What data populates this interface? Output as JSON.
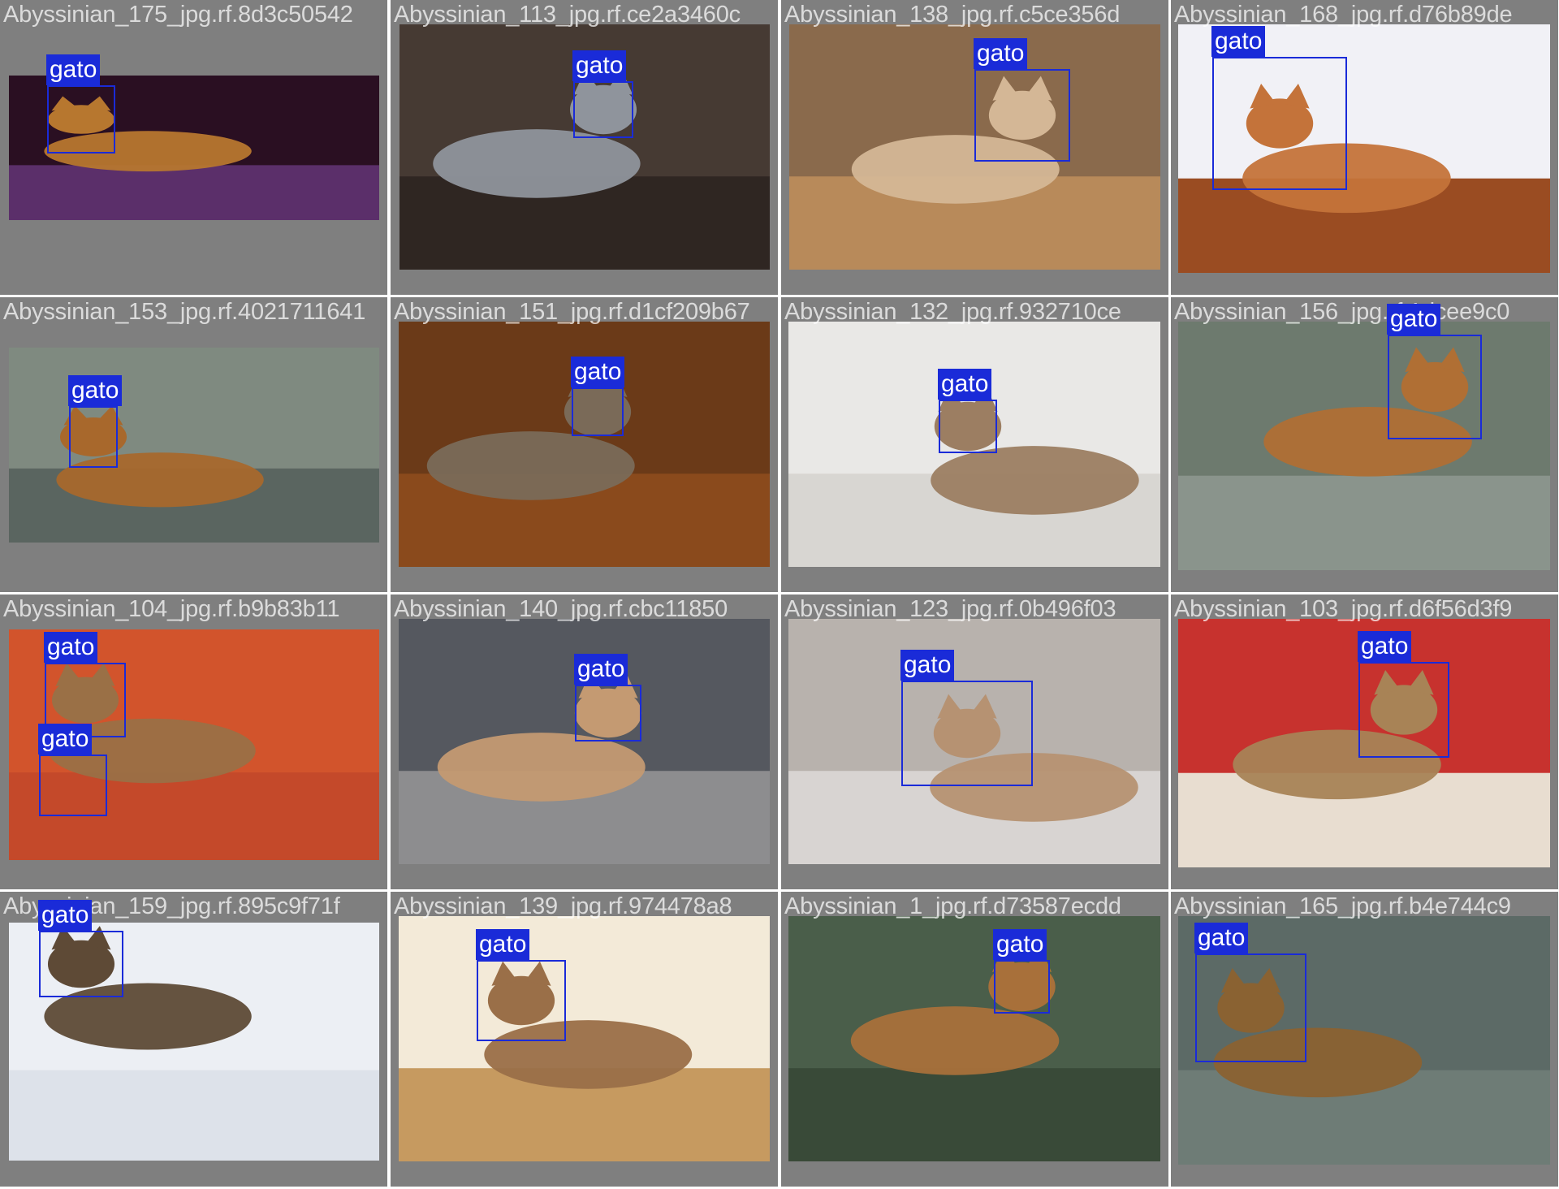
{
  "detection_color": "#1a2bd8",
  "tiles": [
    {
      "filename": "Abyssinian_175_jpg.rf.8d3c50542",
      "detections": [
        {
          "label": "gato"
        }
      ],
      "scene": {
        "bg": "#2a0f22",
        "floor": "#5b2f6a",
        "cat": "#b7772f"
      }
    },
    {
      "filename": "Abyssinian_113_jpg.rf.ce2a3460c",
      "detections": [
        {
          "label": "gato"
        }
      ],
      "scene": {
        "bg": "#463a33",
        "floor": "#2f2622",
        "cat": "#8f949c"
      }
    },
    {
      "filename": "Abyssinian_138_jpg.rf.c5ce356d",
      "detections": [
        {
          "label": "gato"
        }
      ],
      "scene": {
        "bg": "#8a6a4c",
        "floor": "#b88a5a",
        "cat": "#d4b796"
      }
    },
    {
      "filename": "Abyssinian_168_jpg.rf.d76b89de",
      "detections": [
        {
          "label": "gato"
        }
      ],
      "scene": {
        "bg": "#f1f1f6",
        "floor": "#9a4c22",
        "cat": "#c4733a"
      }
    },
    {
      "filename": "Abyssinian_153_jpg.rf.4021711641",
      "detections": [
        {
          "label": "gato"
        }
      ],
      "scene": {
        "bg": "#7f8a80",
        "floor": "#5a6560",
        "cat": "#a8682c"
      }
    },
    {
      "filename": "Abyssinian_151_jpg.rf.d1cf209b67",
      "detections": [
        {
          "label": "gato"
        }
      ],
      "scene": {
        "bg": "#6b3a18",
        "floor": "#8a4a1c",
        "cat": "#7a6a58"
      }
    },
    {
      "filename": "Abyssinian_132_jpg.rf.932710ce",
      "detections": [
        {
          "label": "gato"
        }
      ],
      "scene": {
        "bg": "#e9e8e6",
        "floor": "#d8d6d2",
        "cat": "#9c7e62"
      }
    },
    {
      "filename": "Abyssinian_156_jpg.rf.1dcee9c0",
      "detections": [
        {
          "label": "gato"
        }
      ],
      "scene": {
        "bg": "#6d7a6e",
        "floor": "#8a948c",
        "cat": "#b06f34"
      }
    },
    {
      "filename": "Abyssinian_104_jpg.rf.b9b83b11",
      "detections": [
        {
          "label": "gato"
        },
        {
          "label": "gato"
        }
      ],
      "scene": {
        "bg": "#d2542c",
        "floor": "#c4492a",
        "cat": "#9a7046"
      }
    },
    {
      "filename": "Abyssinian_140_jpg.rf.cbc11850",
      "detections": [
        {
          "label": "gato"
        }
      ],
      "scene": {
        "bg": "#55585f",
        "floor": "#8d8d8f",
        "cat": "#c49a72"
      }
    },
    {
      "filename": "Abyssinian_123_jpg.rf.0b496f03",
      "detections": [
        {
          "label": "gato"
        }
      ],
      "scene": {
        "bg": "#b8b2ad",
        "floor": "#d8d4d2",
        "cat": "#b69272"
      }
    },
    {
      "filename": "Abyssinian_103_jpg.rf.d6f56d3f9",
      "detections": [
        {
          "label": "gato"
        }
      ],
      "scene": {
        "bg": "#c7322e",
        "floor": "#e8ddd0",
        "cat": "#a88356"
      }
    },
    {
      "filename": "Abyssinian_159_jpg.rf.895c9f71f",
      "detections": [
        {
          "label": "gato"
        }
      ],
      "scene": {
        "bg": "#eceff4",
        "floor": "#dde2ea",
        "cat": "#5e4a36"
      }
    },
    {
      "filename": "Abyssinian_139_jpg.rf.974478a8",
      "detections": [
        {
          "label": "gato"
        }
      ],
      "scene": {
        "bg": "#f3ead8",
        "floor": "#c69a60",
        "cat": "#9a6f48"
      }
    },
    {
      "filename": "Abyssinian_1_jpg.rf.d73587ecdd",
      "detections": [
        {
          "label": "gato"
        }
      ],
      "scene": {
        "bg": "#4a5e4a",
        "floor": "#394a38",
        "cat": "#a8703a"
      }
    },
    {
      "filename": "Abyssinian_165_jpg.rf.b4e744c9",
      "detections": [
        {
          "label": "gato"
        }
      ],
      "scene": {
        "bg": "#5c6a66",
        "floor": "#6e7c76",
        "cat": "#8a6232"
      }
    }
  ]
}
